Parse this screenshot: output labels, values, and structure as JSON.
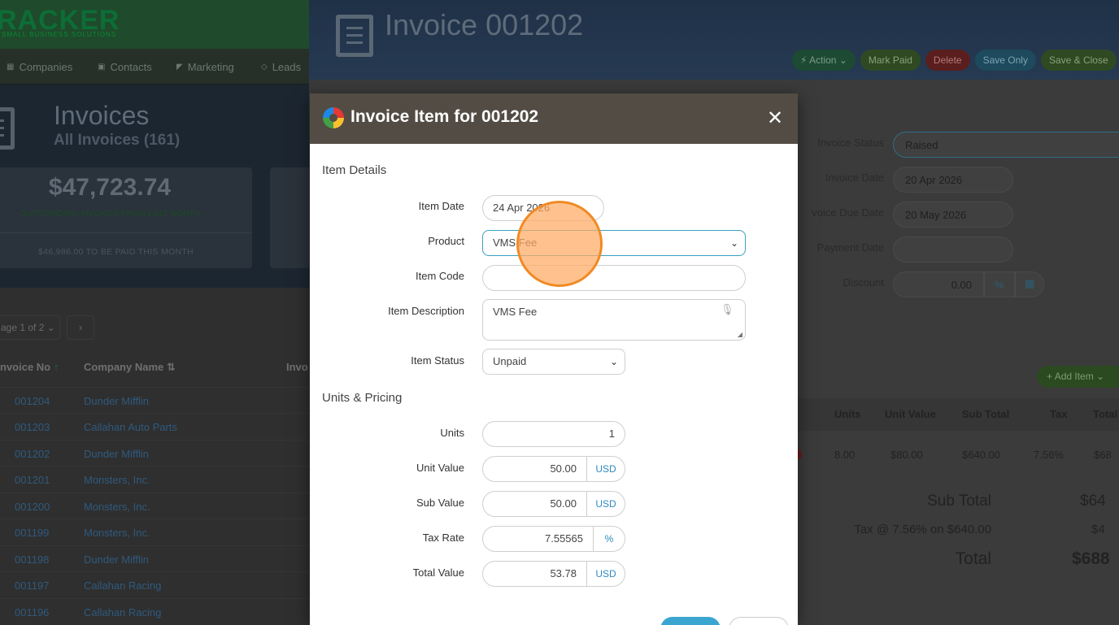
{
  "bg_app": {
    "brand": {
      "logo": "RACKER",
      "sub": "SMALL BUSINESS SOLUTIONS"
    },
    "nav": [
      {
        "label": "Companies",
        "icon": "building-icon"
      },
      {
        "label": "Contacts",
        "icon": "contacts-icon"
      },
      {
        "label": "Marketing",
        "icon": "megaphone-icon"
      },
      {
        "label": "Leads",
        "icon": "diamond-icon"
      }
    ],
    "hero": {
      "title": "Invoices",
      "subtitle": "All Invoices (161)"
    },
    "stat": {
      "amount": "$47,723.74",
      "tag": "OUTSTANDING INVOICES FROM LAST MONTH",
      "pay": "$46,986.00 TO BE PAID THIS MONTH"
    },
    "pager": {
      "label": "age 1 of 2",
      "next": "›"
    },
    "columns": {
      "invoice_no": "nvoice No",
      "company": "Company Name",
      "third": "Invo"
    },
    "rows": [
      {
        "no": "001204",
        "co": "Dunder Mifflin"
      },
      {
        "no": "001203",
        "co": "Callahan Auto Parts"
      },
      {
        "no": "001202",
        "co": "Dunder Mifflin"
      },
      {
        "no": "001201",
        "co": "Monsters, Inc."
      },
      {
        "no": "001200",
        "co": "Monsters, Inc."
      },
      {
        "no": "001199",
        "co": "Monsters, Inc."
      },
      {
        "no": "001198",
        "co": "Dunder Mifflin"
      },
      {
        "no": "001197",
        "co": "Callahan Racing"
      },
      {
        "no": "001196",
        "co": "Callahan Racing"
      }
    ]
  },
  "invoice_page": {
    "title": "Invoice 001202",
    "buttons": {
      "action": "Action",
      "mark_paid": "Mark Paid",
      "delete": "Delete",
      "save_only": "Save Only",
      "save_close": "Save & Close"
    },
    "fields": {
      "status_label": "Invoice Status",
      "status_value": "Raised",
      "date_label": "Invoice Date",
      "date_value": "20 Apr 2026",
      "due_label": "voice Due Date",
      "due_value": "20 May 2026",
      "payment_label": "Payment Date",
      "payment_value": "",
      "discount_label": "Discount",
      "discount_value": "0.00",
      "discount_unit": "%"
    },
    "add_item": "Add Item",
    "table": {
      "headers": [
        "Units",
        "Unit Value",
        "Sub Total",
        "Tax",
        "Total"
      ],
      "row": [
        "8.00",
        "$80.00",
        "$640.00",
        "7.56%",
        "$68"
      ]
    },
    "totals": {
      "sub_label": "Sub Total",
      "sub_value": "$64",
      "tax_label": "Tax @ 7.56% on $640.00",
      "tax_value": "$4",
      "total_label": "Total",
      "total_value": "$688"
    }
  },
  "modal": {
    "title": "Invoice Item for 001202",
    "close": "✕",
    "section_details": "Item Details",
    "item_date_label": "Item Date",
    "item_date": "24 Apr 2026",
    "product_label": "Product",
    "product": "VMS Fee",
    "item_code_label": "Item Code",
    "item_code": "",
    "desc_label": "Item Description",
    "desc": "VMS Fee",
    "status_label": "Item Status",
    "status": "Unpaid",
    "section_pricing": "Units & Pricing",
    "units_label": "Units",
    "units": "1",
    "unit_value_label": "Unit Value",
    "unit_value": "50.00",
    "sub_value_label": "Sub Value",
    "sub_value": "50.00",
    "tax_rate_label": "Tax Rate",
    "tax_rate": "7.55565",
    "total_value_label": "Total Value",
    "total_value": "53.78",
    "currency": "USD",
    "percent": "%"
  }
}
